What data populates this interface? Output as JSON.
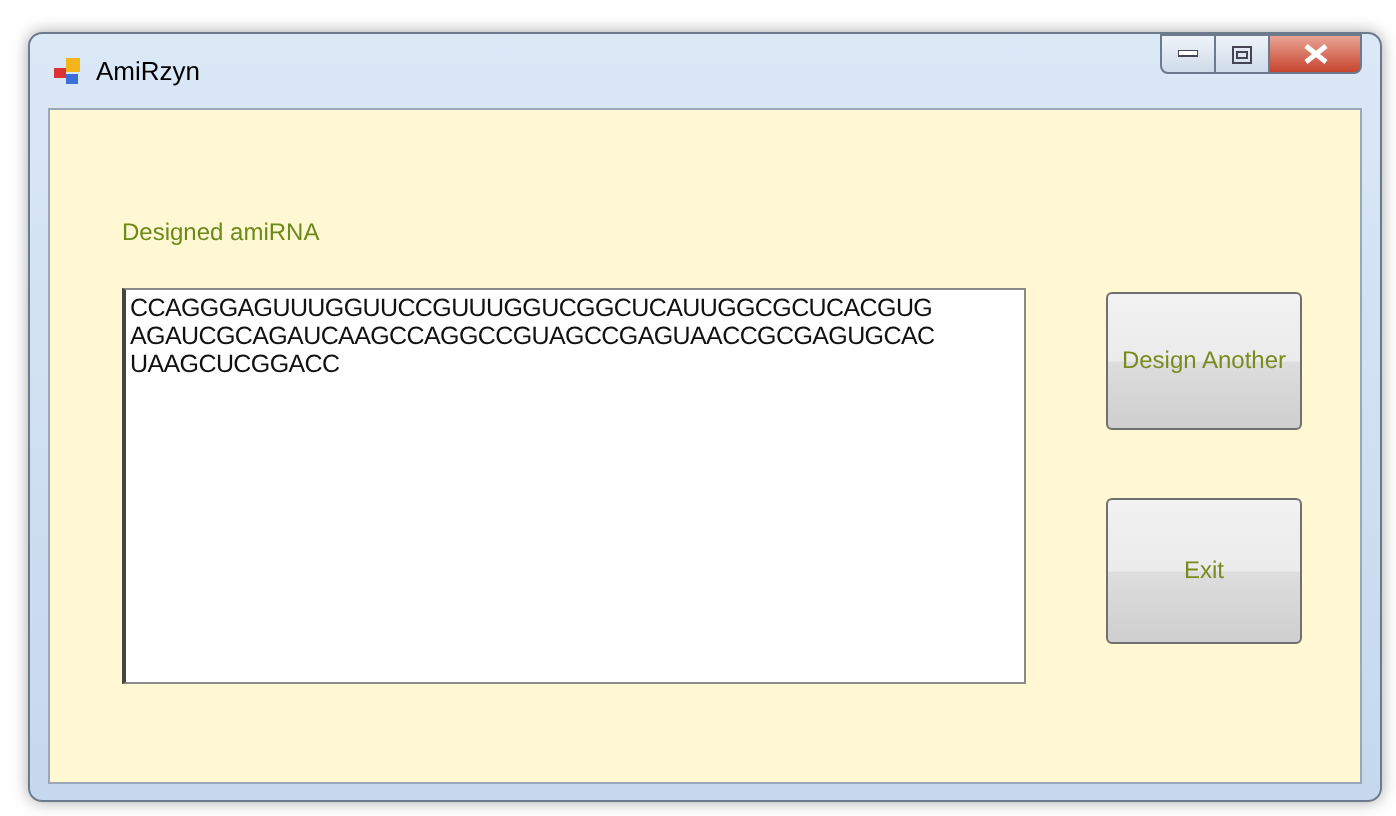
{
  "window": {
    "title": "AmiRzyn"
  },
  "label": "Designed amiRNA",
  "sequence": {
    "lines": [
      "CCAGGGAGUUUGGUUCCGUUUGGUCGGCUCAUUGGCGCUCACGUG",
      "AGAUCGCAGAUCAAGCCAGGCCGUAGCCGAGUAACCGCGAGUGCAC",
      "UAAGCUCGGACC"
    ]
  },
  "buttons": [
    "Design Another",
    "Exit"
  ]
}
